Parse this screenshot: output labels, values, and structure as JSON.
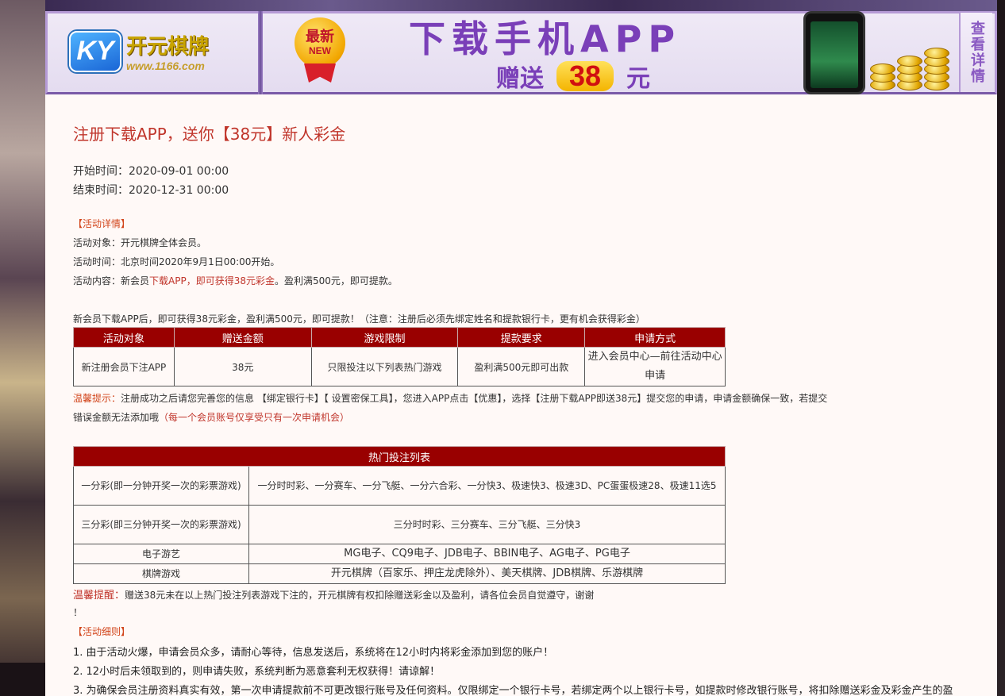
{
  "banner": {
    "logo_badge": "KY",
    "logo_name": "开元棋牌",
    "logo_url": "www.1166.com",
    "new_badge_line1": "最新",
    "new_badge_line2": "NEW",
    "headline": "下载手机APP",
    "sub_prefix": "赠送",
    "sub_amount": "38",
    "sub_suffix": "元",
    "details_button": "查看详情"
  },
  "promo": {
    "title": "注册下载APP，送你【38元】新人彩金",
    "start_time": "开始时间：2020-09-01 00:00",
    "end_time": "结束时间：2020-12-31 00:00",
    "details_heading": "【活动详情】",
    "target": "活动对象：开元棋牌全体会员。",
    "time": "活动时间：北京时间2020年9月1日00:00开始。",
    "content_prefix": "活动内容：新会员",
    "content_highlight": "下载APP，即可获得38元彩金",
    "content_suffix": "。盈利满500元，即可提款。",
    "note": "新会员下载APP后，即可获得38元彩金，盈利满500元，即可提款！（注意：注册后必须先绑定姓名和提款银行卡，更有机会获得彩金）"
  },
  "table1": {
    "headers": [
      "活动对象",
      "赠送金额",
      "游戏限制",
      "提款要求",
      "申请方式"
    ],
    "row": [
      "新注册会员下注APP",
      "38元",
      "只限投注以下列表热门游戏",
      "盈利满500元即可出款",
      "进入会员中心—前往活动中心申请"
    ]
  },
  "reminder": {
    "label": "温馨提示：",
    "text": "注册成功之后请您完善您的信息 【绑定银行卡】【 设置密保工具】，您进入APP点击【优惠】，选择【注册下载APP即送38元】提交您的申请，申请金额确保一致，若提交",
    "text2": "错误金额无法添加哦",
    "highlight": "（每一个会员账号仅享受只有一次申请机会）"
  },
  "table2": {
    "header": "热门投注列表",
    "rows": [
      [
        "一分彩(即一分钟开奖一次的彩票游戏)",
        "一分时时彩、一分赛车、一分飞艇、一分六合彩、一分快3、极速快3、极速3D、PC蛋蛋极速28、极速11选5"
      ],
      [
        "三分彩(即三分钟开奖一次的彩票游戏)",
        "三分时时彩、三分赛车、三分飞艇、三分快3"
      ],
      [
        "电子游艺",
        "MG电子、CQ9电子、JDB电子、BBIN电子、AG电子、PG电子"
      ],
      [
        "棋牌游戏",
        "开元棋牌（百家乐、押庄龙虎除外）、美天棋牌、JDB棋牌、乐游棋牌"
      ]
    ]
  },
  "warning": {
    "label": "温馨提醒：",
    "text": "赠送38元未在以上热门投注列表游戏下注的，开元棋牌有权扣除赠送彩金以及盈利，请各位会员自觉遵守，谢谢",
    "text2": "！"
  },
  "rules": {
    "heading": "【活动细则】",
    "items": [
      "1. 由于活动火爆，申请会员众多，请耐心等待，信息发送后，系统将在12小时内将彩金添加到您的账户！",
      "2. 12小时后未领取到的，则申请失败，系统判断为恶意套利无权获得！请谅解！",
      "3. 为确保会员注册资料真实有效，第一次申请提款前不可更改银行账号及任何资料。仅限绑定一个银行卡号，若绑定两个以上银行卡号，如提款时修改银行账号，将扣除赠送彩金及彩金产生的盈"
    ]
  },
  "colors": {
    "accent_red": "#c0352b",
    "table_header": "#990000",
    "banner_purple": "#7a3fb8",
    "panel_bg": "#fff9f7"
  }
}
